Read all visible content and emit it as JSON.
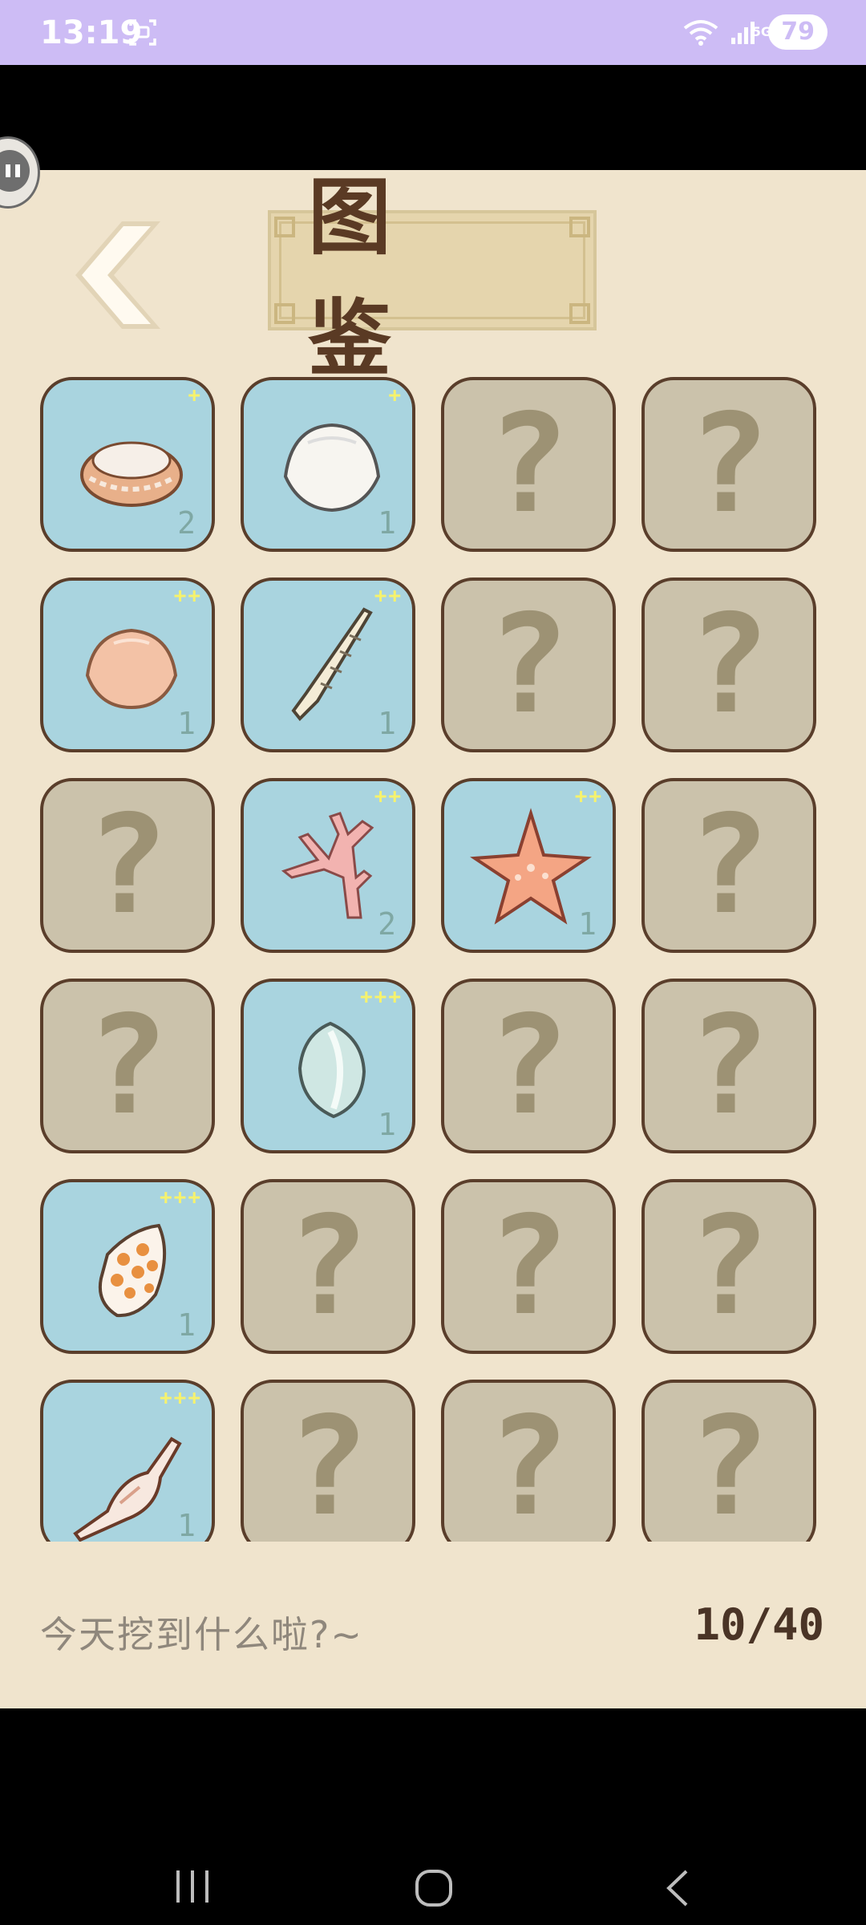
{
  "status_bar": {
    "time": "13:19",
    "network": "5G",
    "battery": "79"
  },
  "header": {
    "title": "图 鉴",
    "back_icon": "chevron-left-icon"
  },
  "collection": {
    "items": [
      {
        "state": "found",
        "item": "clam-shell",
        "stars": "+",
        "count": "2"
      },
      {
        "state": "found",
        "item": "white-shell",
        "stars": "+",
        "count": "1"
      },
      {
        "state": "unknown",
        "mark": "?"
      },
      {
        "state": "unknown",
        "mark": "?"
      },
      {
        "state": "found",
        "item": "peach-shell",
        "stars": "++",
        "count": "1"
      },
      {
        "state": "found",
        "item": "auger-shell",
        "stars": "++",
        "count": "1"
      },
      {
        "state": "unknown",
        "mark": "?"
      },
      {
        "state": "unknown",
        "mark": "?"
      },
      {
        "state": "unknown",
        "mark": "?"
      },
      {
        "state": "found",
        "item": "coral",
        "stars": "++",
        "count": "2"
      },
      {
        "state": "found",
        "item": "starfish",
        "stars": "++",
        "count": "1"
      },
      {
        "state": "unknown",
        "mark": "?"
      },
      {
        "state": "unknown",
        "mark": "?"
      },
      {
        "state": "found",
        "item": "cowrie-shell",
        "stars": "+++",
        "count": "1"
      },
      {
        "state": "unknown",
        "mark": "?"
      },
      {
        "state": "unknown",
        "mark": "?"
      },
      {
        "state": "found",
        "item": "cone-shell",
        "stars": "+++",
        "count": "1"
      },
      {
        "state": "unknown",
        "mark": "?"
      },
      {
        "state": "unknown",
        "mark": "?"
      },
      {
        "state": "unknown",
        "mark": "?"
      },
      {
        "state": "found",
        "item": "spindle-shell",
        "stars": "+++",
        "count": "1"
      },
      {
        "state": "unknown",
        "mark": "?"
      },
      {
        "state": "unknown",
        "mark": "?"
      },
      {
        "state": "unknown",
        "mark": "?"
      }
    ]
  },
  "footer": {
    "tagline": "今天挖到什么啦?~",
    "progress": "10/40"
  },
  "nav_bar": {
    "recents_icon": "recents-icon",
    "home_icon": "home-icon",
    "back_icon": "back-icon"
  },
  "colors": {
    "status_bar": "#cdbcf5",
    "background": "#f0e4cd",
    "found_card": "#a9d4df",
    "unknown_card": "#cbc2ab",
    "card_border": "#5a3e2b"
  }
}
